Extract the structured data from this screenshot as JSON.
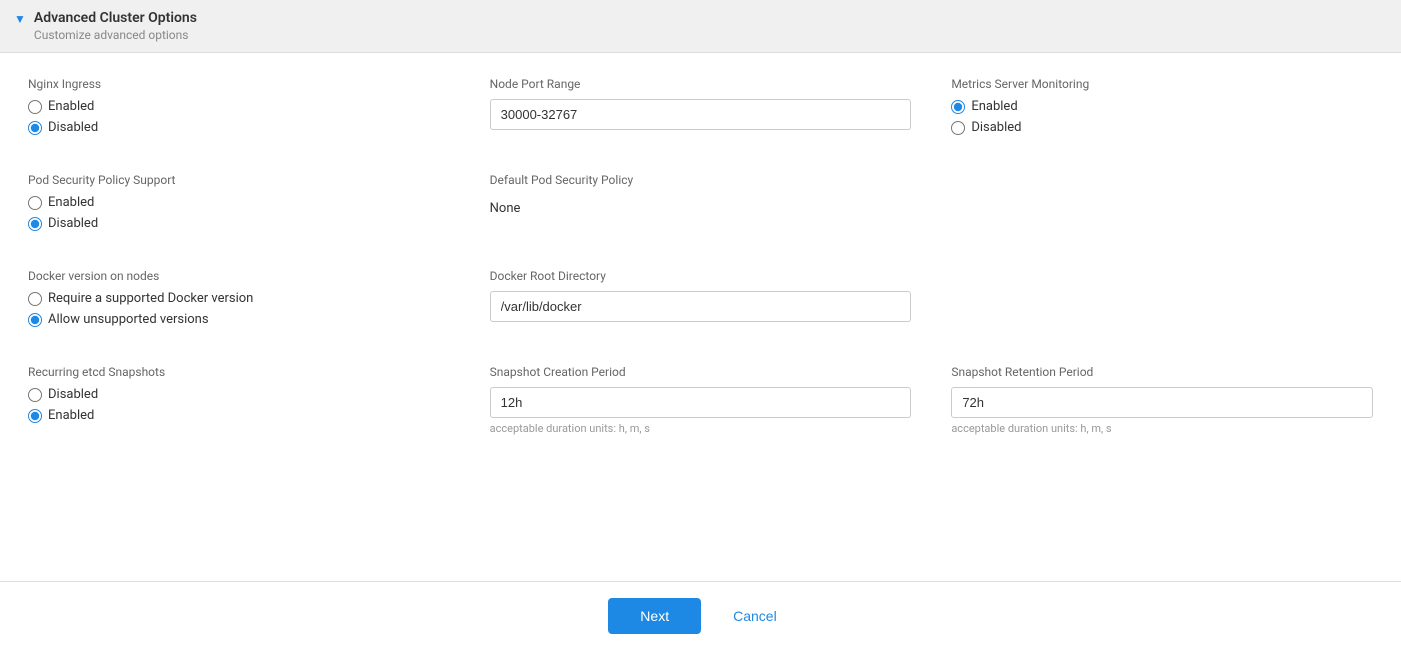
{
  "header": {
    "title": "Advanced Cluster Options",
    "subtitle": "Customize advanced options",
    "triangle": "▼"
  },
  "nginx_ingress": {
    "label": "Nginx Ingress",
    "options": [
      {
        "id": "nginx-enabled",
        "label": "Enabled",
        "checked": false
      },
      {
        "id": "nginx-disabled",
        "label": "Disabled",
        "checked": true
      }
    ]
  },
  "node_port_range": {
    "label": "Node Port Range",
    "value": "30000-32767",
    "placeholder": "30000-32767"
  },
  "metrics_server": {
    "label": "Metrics Server Monitoring",
    "options": [
      {
        "id": "metrics-enabled",
        "label": "Enabled",
        "checked": true
      },
      {
        "id": "metrics-disabled",
        "label": "Disabled",
        "checked": false
      }
    ]
  },
  "pod_security_policy": {
    "label": "Pod Security Policy Support",
    "options": [
      {
        "id": "psp-enabled",
        "label": "Enabled",
        "checked": false
      },
      {
        "id": "psp-disabled",
        "label": "Disabled",
        "checked": true
      }
    ]
  },
  "default_pod_security_policy": {
    "label": "Default Pod Security Policy",
    "value": "None"
  },
  "docker_version": {
    "label": "Docker version on nodes",
    "options": [
      {
        "id": "docker-supported",
        "label": "Require a supported Docker version",
        "checked": false
      },
      {
        "id": "docker-unsupported",
        "label": "Allow unsupported versions",
        "checked": true
      }
    ]
  },
  "docker_root_dir": {
    "label": "Docker Root Directory",
    "value": "/var/lib/docker",
    "placeholder": "/var/lib/docker"
  },
  "recurring_etcd": {
    "label": "Recurring etcd Snapshots",
    "options": [
      {
        "id": "etcd-disabled",
        "label": "Disabled",
        "checked": false
      },
      {
        "id": "etcd-enabled",
        "label": "Enabled",
        "checked": true
      }
    ]
  },
  "snapshot_creation": {
    "label": "Snapshot Creation Period",
    "value": "12h",
    "hint": "acceptable duration units: h, m, s"
  },
  "snapshot_retention": {
    "label": "Snapshot Retention Period",
    "value": "72h",
    "hint": "acceptable duration units: h, m, s"
  },
  "footer": {
    "next_label": "Next",
    "cancel_label": "Cancel"
  }
}
